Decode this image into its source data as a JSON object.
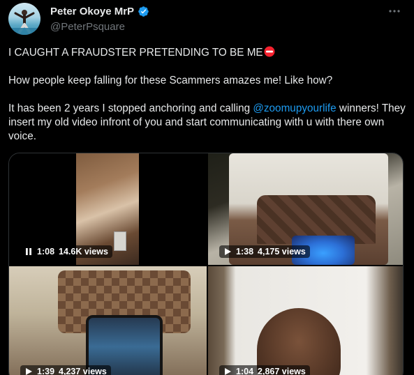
{
  "tweet": {
    "author": {
      "name": "Peter Okoye MrP",
      "handle": "@PeterPsquare",
      "verified": true
    },
    "text": {
      "line1": "I CAUGHT A FRAUDSTER PRETENDING TO BE ME",
      "line2": "How people keep falling for these Scammers amazes me! Like how?",
      "line3_prefix": "It has been 2 years I stopped anchoring and calling ",
      "mention": "@zoomupyourlife",
      "line3_suffix": " winners! They insert my old video infront of you and start communicating with u with there own voice."
    },
    "media": [
      {
        "state": "pause",
        "duration": "1:08",
        "views": "14.6K views"
      },
      {
        "state": "play",
        "duration": "1:38",
        "views": "4,175 views"
      },
      {
        "state": "play",
        "duration": "1:39",
        "views": "4,237 views"
      },
      {
        "state": "play",
        "duration": "1:04",
        "views": "2,867 views"
      }
    ]
  },
  "colors": {
    "background": "#000000",
    "text_primary": "#e7e9ea",
    "text_secondary": "#71767b",
    "link": "#1d9bf0",
    "verified_badge": "#1d9bf0",
    "no_entry": "#f4212e",
    "border": "#2f3336"
  },
  "icons": [
    "verified-badge-icon",
    "more-options-icon",
    "no-entry-emoji-icon",
    "pause-icon",
    "play-icon"
  ]
}
